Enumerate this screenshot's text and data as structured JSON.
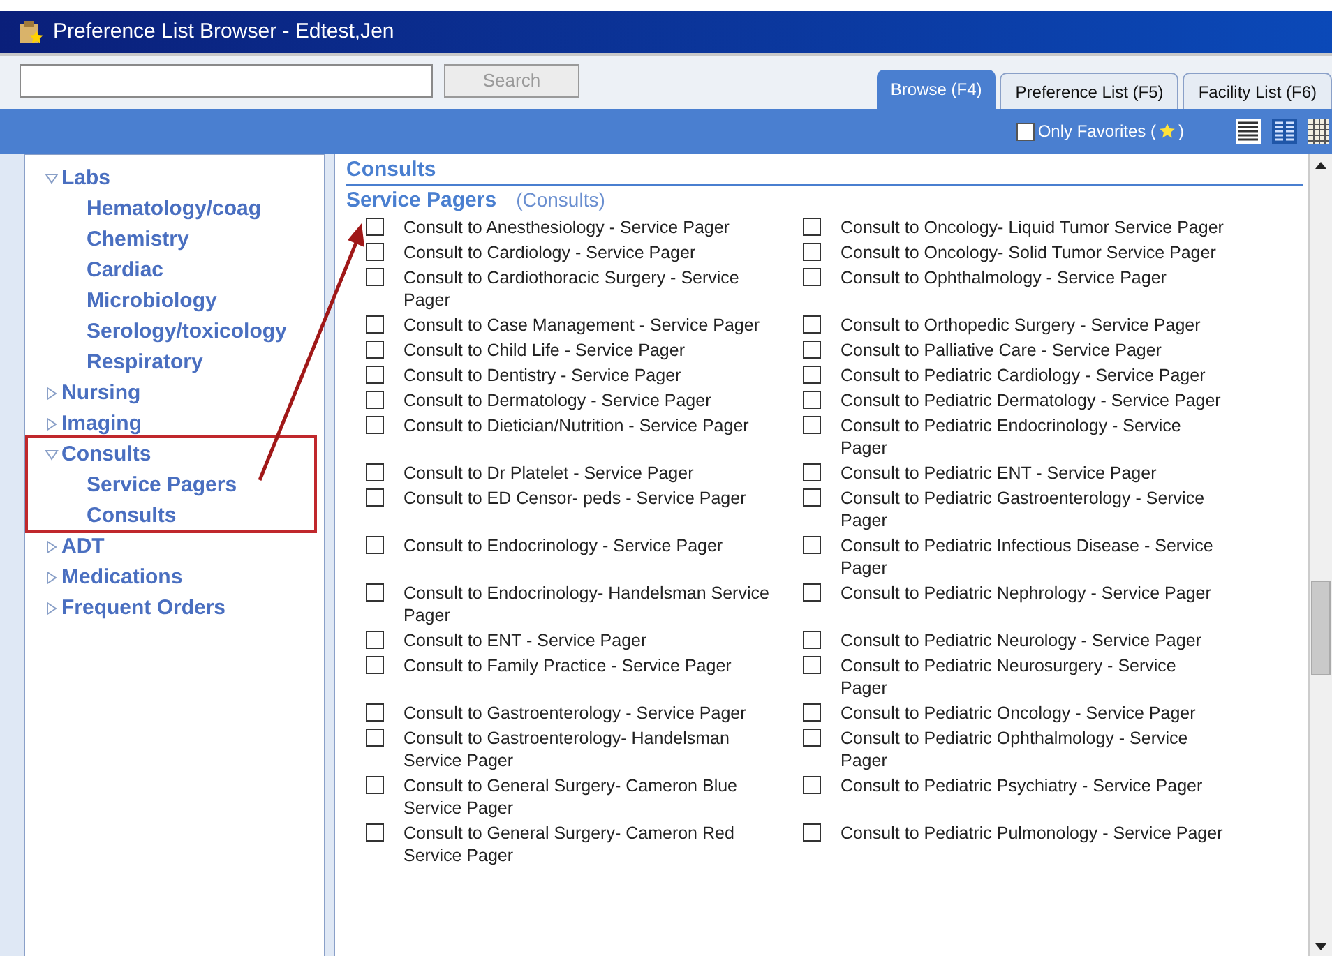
{
  "window": {
    "title": "Preference List Browser - Edtest,Jen"
  },
  "search": {
    "button": "Search"
  },
  "tabs": [
    {
      "label": "Browse (F4)",
      "selected": true
    },
    {
      "label": "Preference List (F5)",
      "selected": false
    },
    {
      "label": "Facility List (F6)",
      "selected": false
    }
  ],
  "favorites": {
    "label": "Only Favorites (",
    "suffix": ")",
    "checked": false
  },
  "sidebar": {
    "items": [
      {
        "label": "Labs",
        "expanded": true,
        "children": [
          {
            "label": "Hematology/coag"
          },
          {
            "label": "Chemistry"
          },
          {
            "label": "Cardiac"
          },
          {
            "label": "Microbiology"
          },
          {
            "label": "Serology/toxicology"
          },
          {
            "label": "Respiratory"
          }
        ]
      },
      {
        "label": "Nursing",
        "expanded": false
      },
      {
        "label": "Imaging",
        "expanded": false
      },
      {
        "label": "Consults",
        "expanded": true,
        "children": [
          {
            "label": "Service Pagers"
          },
          {
            "label": "Consults"
          }
        ]
      },
      {
        "label": "ADT",
        "expanded": false
      },
      {
        "label": "Medications",
        "expanded": false
      },
      {
        "label": "Frequent Orders",
        "expanded": false
      }
    ]
  },
  "content": {
    "heading": "Consults",
    "section": "Service Pagers",
    "section_note": "(Consults)",
    "items": [
      {
        "label": "Consult to Anesthesiology - Service Pager",
        "checked": false
      },
      {
        "label": "Consult to Oncology- Liquid Tumor Service Pager",
        "checked": false
      },
      {
        "label": "Consult to Cardiology - Service Pager",
        "checked": false
      },
      {
        "label": "Consult to Oncology- Solid Tumor Service Pager",
        "checked": false
      },
      {
        "label": "Consult to Cardiothoracic Surgery - Service Pager",
        "checked": false
      },
      {
        "label": "Consult to Ophthalmology - Service Pager",
        "checked": false
      },
      {
        "label": "Consult to Case Management - Service Pager",
        "checked": false
      },
      {
        "label": "Consult to Orthopedic Surgery - Service Pager",
        "checked": false
      },
      {
        "label": "Consult to Child Life - Service Pager",
        "checked": false
      },
      {
        "label": "Consult to Palliative Care - Service Pager",
        "checked": false
      },
      {
        "label": "Consult to Dentistry - Service Pager",
        "checked": false
      },
      {
        "label": "Consult to Pediatric Cardiology - Service Pager",
        "checked": false
      },
      {
        "label": "Consult to Dermatology - Service Pager",
        "checked": false
      },
      {
        "label": "Consult to Pediatric Dermatology - Service Pager",
        "checked": false
      },
      {
        "label": "Consult to Dietician/Nutrition - Service Pager",
        "checked": false
      },
      {
        "label": "Consult to Pediatric Endocrinology - Service Pager",
        "checked": false
      },
      {
        "label": "Consult to Dr Platelet - Service Pager",
        "checked": false
      },
      {
        "label": "Consult to Pediatric ENT - Service Pager",
        "checked": false
      },
      {
        "label": "Consult to ED Censor- peds - Service Pager",
        "checked": false
      },
      {
        "label": "Consult to Pediatric Gastroenterology - Service Pager",
        "checked": false
      },
      {
        "label": "Consult to Endocrinology - Service Pager",
        "checked": false
      },
      {
        "label": "Consult to Pediatric Infectious Disease - Service Pager",
        "checked": false
      },
      {
        "label": "Consult to Endocrinology- Handelsman Service Pager",
        "checked": false
      },
      {
        "label": "Consult to Pediatric Nephrology - Service Pager",
        "checked": false
      },
      {
        "label": "Consult to ENT - Service Pager",
        "checked": false
      },
      {
        "label": "Consult to Pediatric Neurology - Service Pager",
        "checked": false
      },
      {
        "label": "Consult to Family Practice - Service Pager",
        "checked": false
      },
      {
        "label": "Consult to Pediatric Neurosurgery - Service Pager",
        "checked": false
      },
      {
        "label": "Consult to Gastroenterology - Service Pager",
        "checked": false
      },
      {
        "label": "Consult to Pediatric Oncology - Service Pager",
        "checked": false
      },
      {
        "label": "Consult to Gastroenterology- Handelsman Service Pager",
        "checked": false
      },
      {
        "label": "Consult to Pediatric Ophthalmology - Service Pager",
        "checked": false
      },
      {
        "label": "Consult to General Surgery- Cameron Blue Service Pager",
        "checked": false
      },
      {
        "label": "Consult to Pediatric Psychiatry - Service Pager",
        "checked": false
      },
      {
        "label": "Consult to General Surgery- Cameron Red Service Pager",
        "checked": false
      },
      {
        "label": "Consult to Pediatric Pulmonology - Service Pager",
        "checked": false
      }
    ]
  }
}
